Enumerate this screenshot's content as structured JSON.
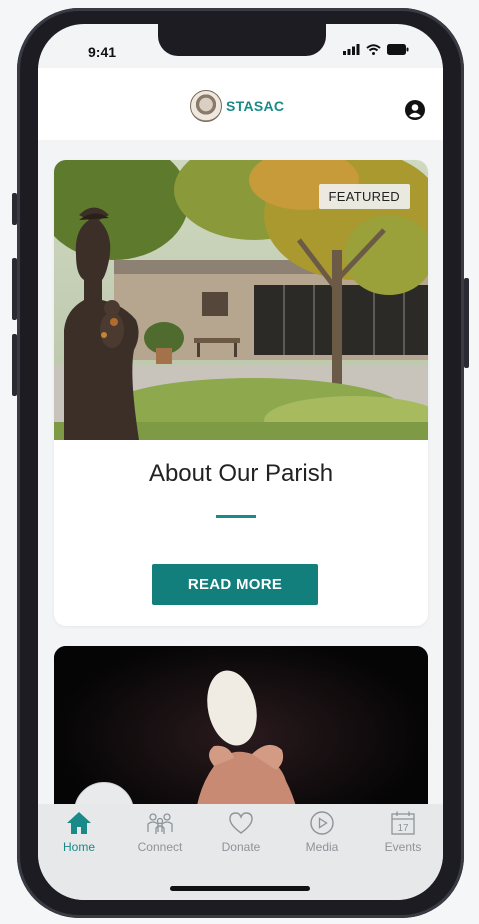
{
  "status_bar": {
    "time": "9:41"
  },
  "header": {
    "brand": "STASAC",
    "account_icon": "user-circle-icon"
  },
  "featured_card": {
    "badge": "FEATURED",
    "title": "About Our Parish",
    "button_label": "READ MORE"
  },
  "tabs": [
    {
      "label": "Home",
      "icon": "home-icon",
      "active": true
    },
    {
      "label": "Connect",
      "icon": "people-icon",
      "active": false
    },
    {
      "label": "Donate",
      "icon": "heart-icon",
      "active": false
    },
    {
      "label": "Media",
      "icon": "play-icon",
      "active": false
    },
    {
      "label": "Events",
      "icon": "calendar-icon",
      "active": false,
      "calendar_day": "17"
    }
  ],
  "colors": {
    "accent": "#1a8a88",
    "button": "#127f7c",
    "tab_inactive": "#8e9499"
  }
}
